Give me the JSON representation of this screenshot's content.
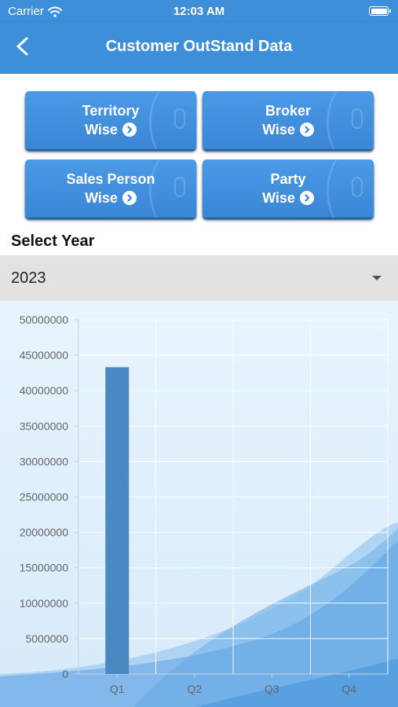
{
  "status_bar": {
    "carrier": "Carrier",
    "time": "12:03 AM"
  },
  "nav": {
    "title": "Customer OutStand Data",
    "back_icon": "chevron-left-icon"
  },
  "tiles": [
    {
      "line1": "Territory",
      "line2": "Wise"
    },
    {
      "line1": "Broker",
      "line2": "Wise"
    },
    {
      "line1": "Sales Person",
      "line2": "Wise"
    },
    {
      "line1": "Party",
      "line2": "Wise"
    }
  ],
  "select_year": {
    "label": "Select Year",
    "value": "2023"
  },
  "colors": {
    "primary": "#3e8fd9",
    "bar": "#4a88c2",
    "select_bg": "#e2e2e2"
  },
  "chart_data": {
    "type": "bar",
    "categories": [
      "Q1",
      "Q2",
      "Q3",
      "Q4"
    ],
    "values": [
      43300000,
      0,
      0,
      0
    ],
    "ylim": [
      0,
      50000000
    ],
    "yticks": [
      "0",
      "5000000",
      "10000000",
      "15000000",
      "20000000",
      "25000000",
      "30000000",
      "35000000",
      "40000000",
      "45000000",
      "50000000"
    ],
    "grid": true,
    "legend": false
  }
}
